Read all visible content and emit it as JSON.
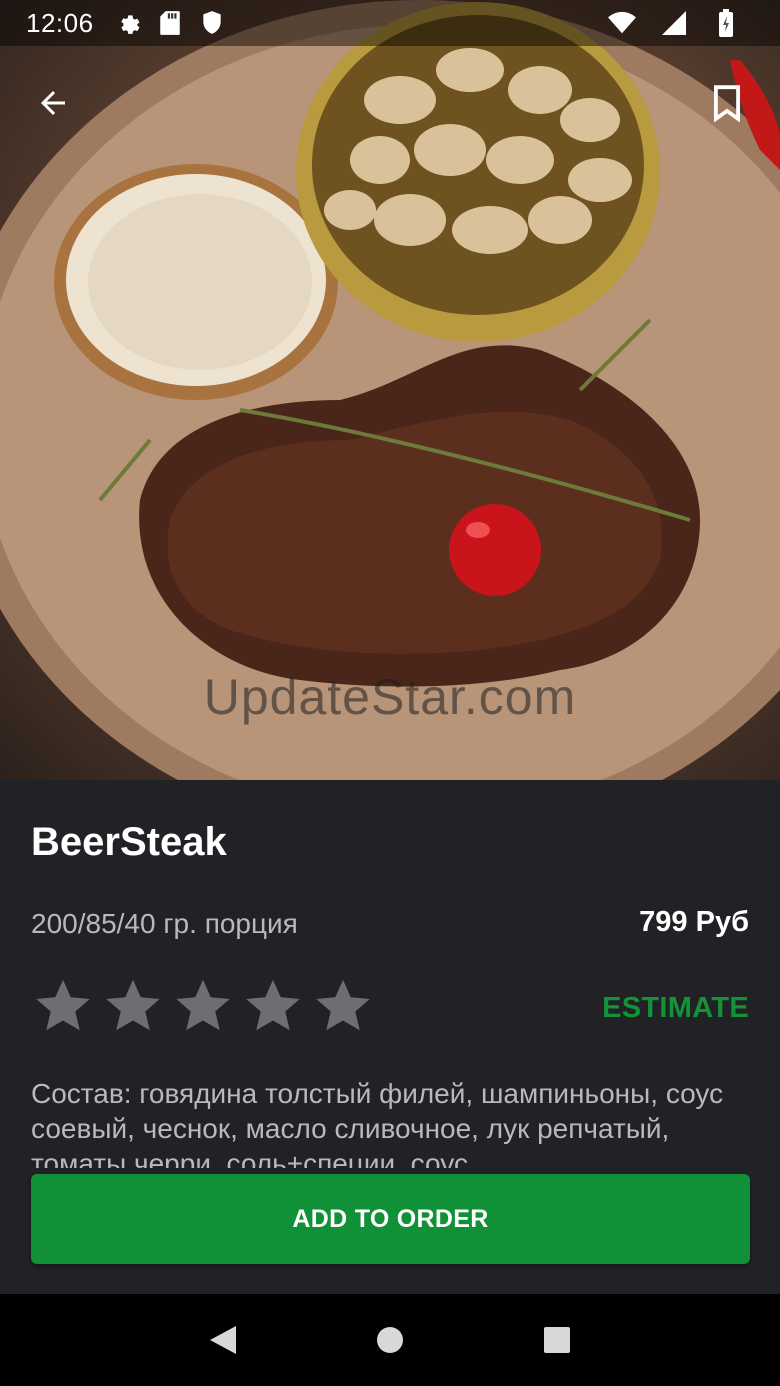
{
  "status_bar": {
    "time": "12:06",
    "left_icons": [
      "gear-icon",
      "sd-card-icon",
      "shield-icon"
    ],
    "right_icons": [
      "wifi-icon",
      "signal-icon",
      "battery-icon"
    ]
  },
  "toolbar": {
    "back_icon": "arrow-left-icon",
    "bookmark_icon": "bookmark-icon"
  },
  "hero": {
    "watermark": "UpdateStar.com"
  },
  "product": {
    "title": "BeerSteak",
    "portion": "200/85/40 гр. порция",
    "price": "799 Руб",
    "rating": {
      "value": 0,
      "max": 5
    },
    "estimate_label": "ESTIMATE",
    "description": "Состав: говядина толстый филей, шампиньоны, соус соевый, чеснок, масло сливочное, лук репчатый, томаты черри, соль+специи, соус"
  },
  "actions": {
    "add_to_order": "ADD TO ORDER"
  },
  "nav_bar": {
    "icons": [
      "back-triangle-icon",
      "home-circle-icon",
      "recents-square-icon"
    ]
  },
  "colors": {
    "background": "#202226",
    "accent_green": "#119137",
    "estimate_green": "#149336",
    "star_gray": "#6c6e72",
    "secondary_text": "#b8b9bb"
  }
}
